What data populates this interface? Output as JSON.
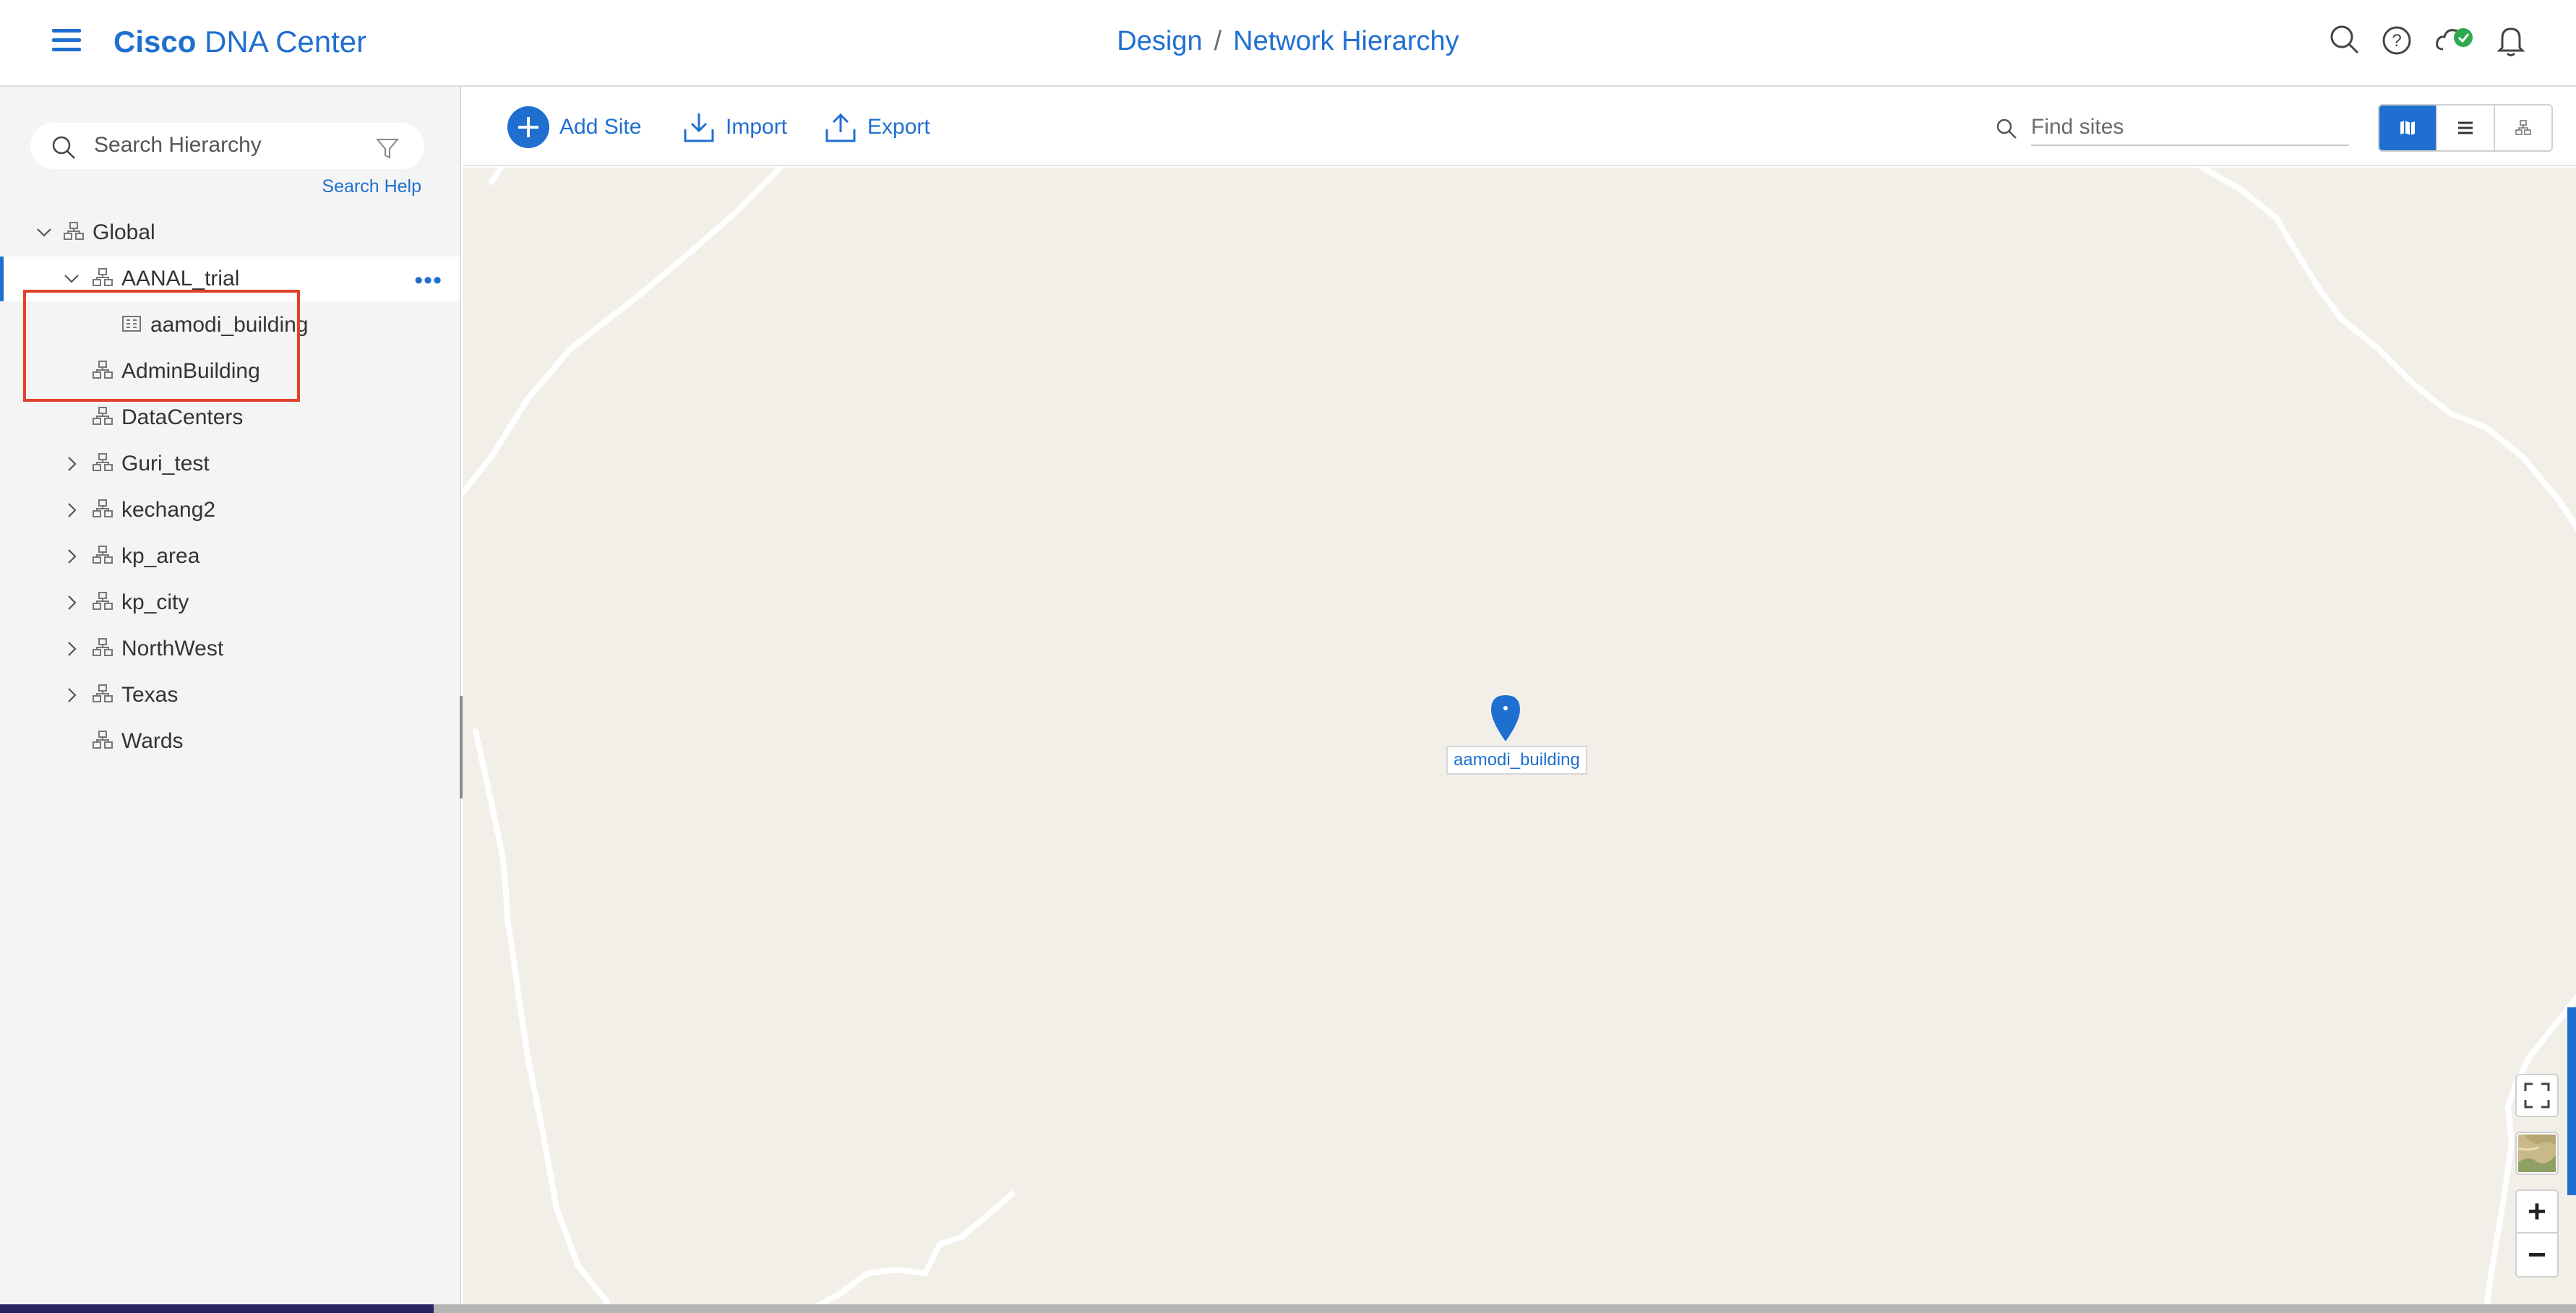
{
  "header": {
    "brand_bold": "Cisco",
    "brand_rest": "DNA Center",
    "breadcrumb": [
      "Design",
      "Network Hierarchy"
    ],
    "separator": "/",
    "icons": [
      "search-icon",
      "help-icon",
      "cloud-status-icon",
      "notifications-icon"
    ],
    "status_color": "#2fa84f"
  },
  "sidebar": {
    "search_placeholder": "Search Hierarchy",
    "search_help": "Search Help",
    "tree": [
      {
        "label": "Global",
        "chevron": "down",
        "icon": "site-icon",
        "level": 0
      },
      {
        "label": "AANAL_trial",
        "chevron": "down",
        "icon": "site-icon",
        "level": 1,
        "selected": true
      },
      {
        "label": "aamodi_building",
        "chevron": "",
        "icon": "building-icon",
        "level": 2
      },
      {
        "label": "AdminBuilding",
        "chevron": "",
        "icon": "site-icon",
        "level": 1
      },
      {
        "label": "DataCenters",
        "chevron": "",
        "icon": "site-icon",
        "level": 1
      },
      {
        "label": "Guri_test",
        "chevron": "right",
        "icon": "site-icon",
        "level": 1
      },
      {
        "label": "kechang2",
        "chevron": "right",
        "icon": "site-icon",
        "level": 1
      },
      {
        "label": "kp_area",
        "chevron": "right",
        "icon": "site-icon",
        "level": 1
      },
      {
        "label": "kp_city",
        "chevron": "right",
        "icon": "site-icon",
        "level": 1
      },
      {
        "label": "NorthWest",
        "chevron": "right",
        "icon": "site-icon",
        "level": 1
      },
      {
        "label": "Texas",
        "chevron": "right",
        "icon": "site-icon",
        "level": 1
      },
      {
        "label": "Wards",
        "chevron": "",
        "icon": "site-icon",
        "level": 1
      }
    ],
    "more_glyph": "•••"
  },
  "toolbar": {
    "add_site": "Add Site",
    "import": "Import",
    "export": "Export",
    "find_placeholder": "Find sites",
    "views": [
      "map-view-icon",
      "list-view-icon",
      "hierarchy-view-icon"
    ],
    "active_view": "map-view-icon"
  },
  "map": {
    "pin_label": "aamodi_building",
    "controls": {
      "zoom_in": "+",
      "zoom_out": "−"
    },
    "background": "#f2efe9",
    "accent": "#1f6fd0"
  },
  "colors": {
    "accent": "#1f6fd0",
    "highlight": "#e2412a"
  }
}
